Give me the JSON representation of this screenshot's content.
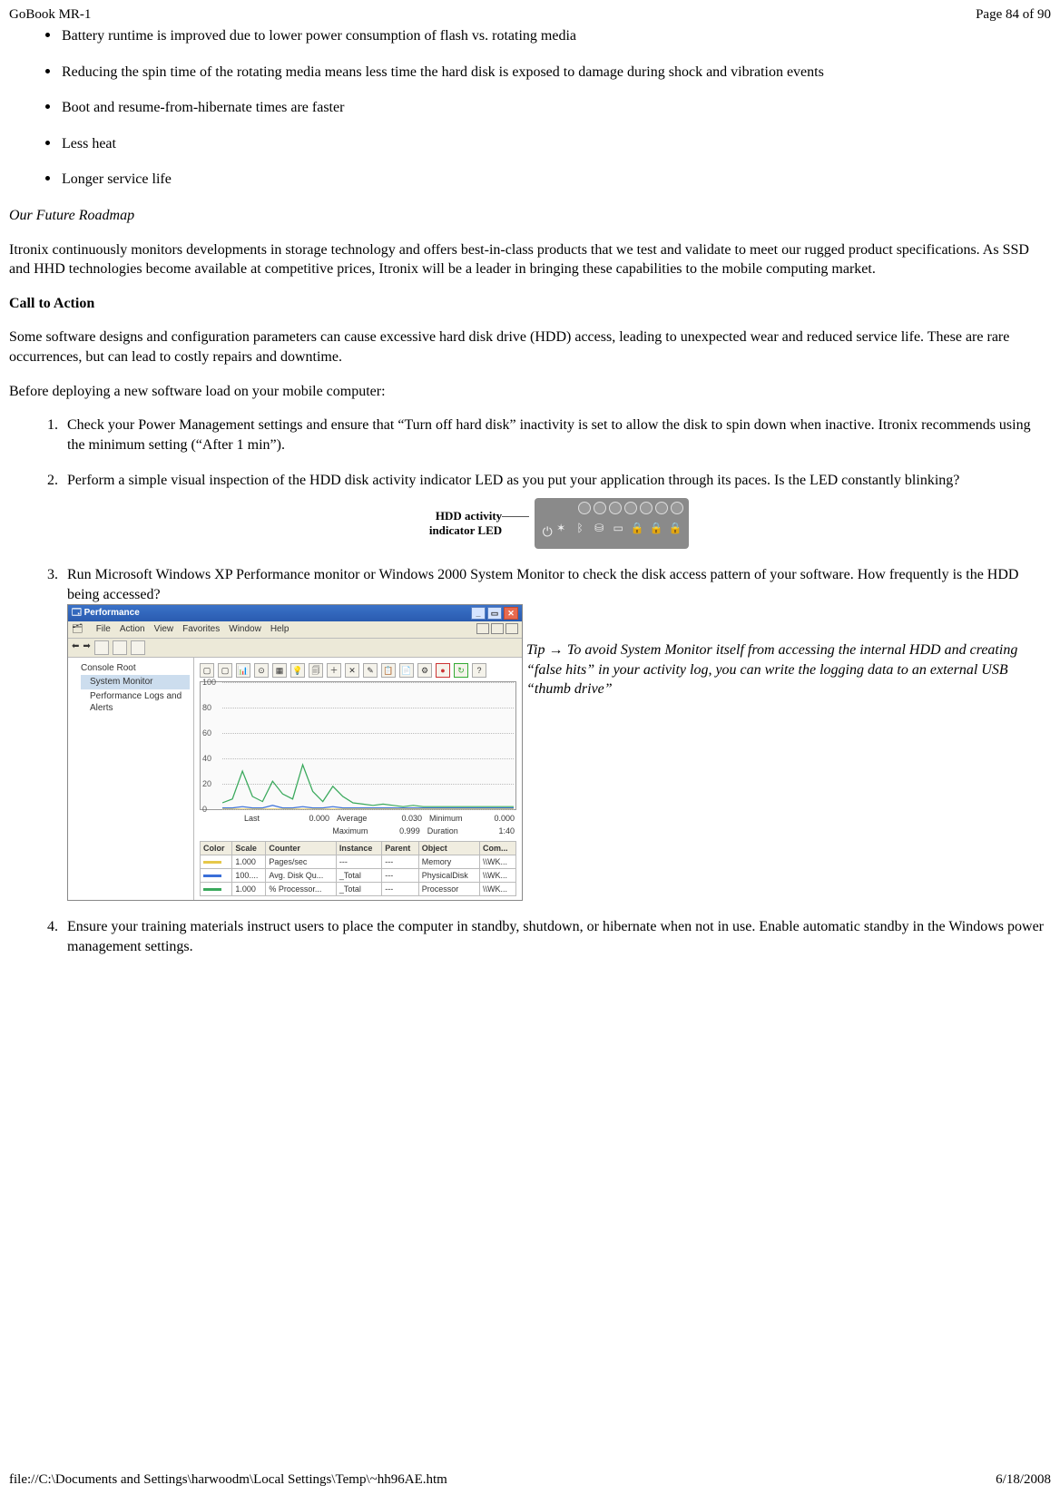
{
  "header": {
    "title": "GoBook MR-1",
    "page_indicator": "Page 84 of 90"
  },
  "footer": {
    "path": "file://C:\\Documents and Settings\\harwoodm\\Local Settings\\Temp\\~hh96AE.htm",
    "date": "6/18/2008"
  },
  "bullets": [
    "Battery runtime is improved due to lower power consumption of flash vs. rotating media",
    "Reducing the spin time of the rotating media means less time the hard disk is exposed to damage during shock and vibration events",
    "Boot and resume-from-hibernate times are faster",
    "Less heat",
    "Longer service life"
  ],
  "roadmap": {
    "heading": "Our Future Roadmap",
    "text": "Itronix continuously monitors developments in storage technology and offers best-in-class products that we test and validate to meet our rugged product specifications.  As SSD and HHD technologies become available at competitive prices, Itronix will be a leader in bringing these capabilities to the mobile computing market."
  },
  "call": {
    "heading": "Call to Action",
    "intro": "Some software designs and configuration parameters can cause excessive hard disk drive (HDD) access, leading to unexpected wear and reduced service life.  These are rare occurrences, but can lead to costly repairs and downtime.",
    "before": "Before deploying a new software load on your mobile computer:"
  },
  "steps": {
    "s1": "Check your Power Management settings and ensure that “Turn off hard disk” inactivity is set to allow the disk to spin down when inactive.  Itronix recommends using the minimum setting (“After 1 min”).",
    "s2": "Perform a simple visual inspection of the HDD disk activity indicator LED as you put your application through its paces.  Is the LED constantly blinking?",
    "s3": "Run Microsoft Windows XP Performance monitor or Windows 2000 System Monitor to check the disk access pattern of your software.  How frequently is the HDD being accessed?",
    "s4": "Ensure your training materials instruct users to place the computer in standby, shutdown, or hibernate when not in use.  Enable automatic standby in the Windows power management settings."
  },
  "hdd_figure": {
    "label_line1": "HDD activity",
    "label_line2": "indicator LED"
  },
  "tip": {
    "prefix": "Tip ",
    "text": "To avoid System Monitor itself from accessing the internal HDD and creating “false hits” in your activity log, you can write the logging data to an external USB “thumb drive”"
  },
  "perf": {
    "title": "Performance",
    "menu": [
      "File",
      "Action",
      "View",
      "Favorites",
      "Window",
      "Help"
    ],
    "tree": {
      "root": "Console Root",
      "n1": "System Monitor",
      "n2": "Performance Logs and Alerts"
    },
    "stats": {
      "last_label": "Last",
      "last": "0.000",
      "avg_label": "Average",
      "avg": "0.030",
      "min_label": "Minimum",
      "min": "0.000",
      "max_label": "Maximum",
      "max": "0.999",
      "dur_label": "Duration",
      "dur": "1:40"
    },
    "cols": [
      "Color",
      "Scale",
      "Counter",
      "Instance",
      "Parent",
      "Object",
      "Com..."
    ],
    "rows": [
      {
        "color": "#e6c84a",
        "scale": "1.000",
        "counter": "Pages/sec",
        "instance": "---",
        "parent": "---",
        "object": "Memory",
        "comp": "\\\\WK..."
      },
      {
        "color": "#3a6fd8",
        "scale": "100....",
        "counter": "Avg. Disk Qu...",
        "instance": "_Total",
        "parent": "---",
        "object": "PhysicalDisk",
        "comp": "\\\\WK..."
      },
      {
        "color": "#3aa95c",
        "scale": "1.000",
        "counter": "% Processor...",
        "instance": "_Total",
        "parent": "---",
        "object": "Processor",
        "comp": "\\\\WK..."
      }
    ]
  },
  "chart_data": {
    "type": "line",
    "title": "",
    "xlabel": "",
    "ylabel": "",
    "ylim": [
      0,
      100
    ],
    "yticks": [
      0,
      20,
      40,
      60,
      80,
      100
    ],
    "series": [
      {
        "name": "% Processor Time",
        "color": "#3aa95c",
        "values": [
          5,
          8,
          30,
          10,
          6,
          22,
          12,
          8,
          35,
          14,
          6,
          18,
          10,
          5,
          4,
          3,
          4,
          3,
          2,
          3,
          2,
          2,
          2,
          2,
          2,
          2,
          2,
          2,
          2,
          2
        ]
      },
      {
        "name": "Avg. Disk Queue",
        "color": "#3a6fd8",
        "values": [
          1,
          1,
          2,
          1,
          1,
          3,
          1,
          1,
          2,
          1,
          1,
          2,
          1,
          1,
          1,
          1,
          1,
          1,
          1,
          1,
          1,
          1,
          1,
          1,
          1,
          1,
          1,
          1,
          1,
          1
        ]
      },
      {
        "name": "Pages/sec",
        "color": "#e6c84a",
        "values": [
          0,
          0,
          0,
          0,
          0,
          0,
          0,
          0,
          0,
          0,
          0,
          0,
          0,
          0,
          0,
          0,
          0,
          0,
          0,
          0,
          0,
          0,
          0,
          0,
          0,
          0,
          0,
          0,
          0,
          0
        ]
      }
    ]
  }
}
